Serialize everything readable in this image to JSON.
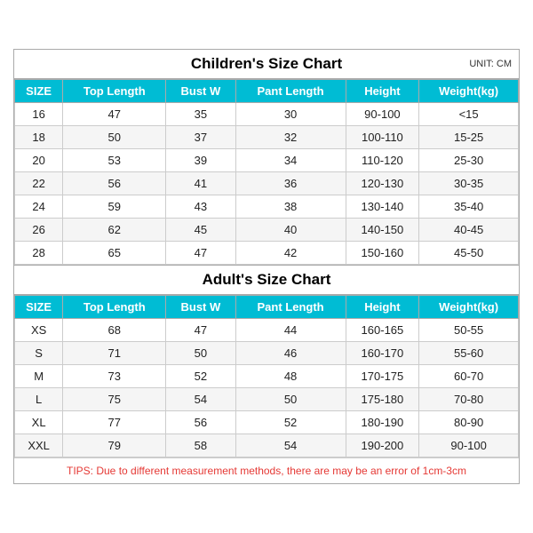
{
  "children_title": "Children's Size Chart",
  "adult_title": "Adult's Size Chart",
  "unit": "UNIT: CM",
  "headers": [
    "SIZE",
    "Top Length",
    "Bust W",
    "Pant Length",
    "Height",
    "Weight(kg)"
  ],
  "children_rows": [
    [
      "16",
      "47",
      "35",
      "30",
      "90-100",
      "<15"
    ],
    [
      "18",
      "50",
      "37",
      "32",
      "100-110",
      "15-25"
    ],
    [
      "20",
      "53",
      "39",
      "34",
      "110-120",
      "25-30"
    ],
    [
      "22",
      "56",
      "41",
      "36",
      "120-130",
      "30-35"
    ],
    [
      "24",
      "59",
      "43",
      "38",
      "130-140",
      "35-40"
    ],
    [
      "26",
      "62",
      "45",
      "40",
      "140-150",
      "40-45"
    ],
    [
      "28",
      "65",
      "47",
      "42",
      "150-160",
      "45-50"
    ]
  ],
  "adult_rows": [
    [
      "XS",
      "68",
      "47",
      "44",
      "160-165",
      "50-55"
    ],
    [
      "S",
      "71",
      "50",
      "46",
      "160-170",
      "55-60"
    ],
    [
      "M",
      "73",
      "52",
      "48",
      "170-175",
      "60-70"
    ],
    [
      "L",
      "75",
      "54",
      "50",
      "175-180",
      "70-80"
    ],
    [
      "XL",
      "77",
      "56",
      "52",
      "180-190",
      "80-90"
    ],
    [
      "XXL",
      "79",
      "58",
      "54",
      "190-200",
      "90-100"
    ]
  ],
  "tips": "TIPS: Due to different measurement methods, there are may be an error of 1cm-3cm",
  "tips_label": "TIPS:"
}
